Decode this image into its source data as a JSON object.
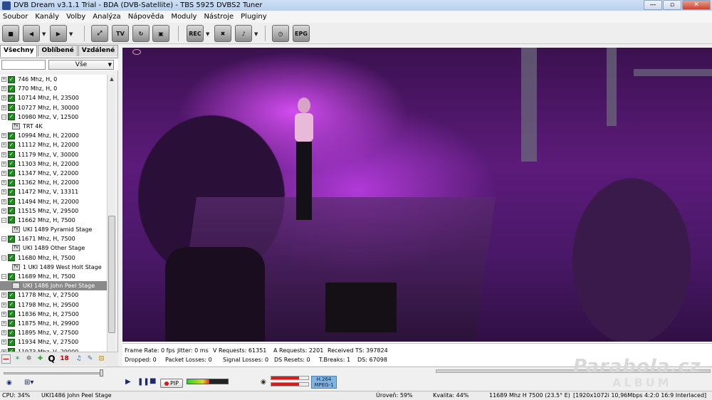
{
  "window": {
    "title": "DVB Dream v3.1.1 Trial - BDA (DVB-Satellite)  -  TBS 5925 DVBS2 Tuner",
    "minimize": "—",
    "restore": "▫",
    "close": "✕"
  },
  "menu": [
    "Soubor",
    "Kanály",
    "Volby",
    "Analýza",
    "Nápověda",
    "Moduly",
    "Nástroje",
    "Pluginy"
  ],
  "toolbar": {
    "tv_label": "TV",
    "rec_label": "REC",
    "epg_label": "EPG"
  },
  "sidebar": {
    "tabs": [
      "Všechny",
      "Oblíbené",
      "Vzdálené"
    ],
    "filter_value": "",
    "filter_select": "Vše",
    "tree": [
      {
        "label": "746 Mhz, H, 0",
        "type": "tp"
      },
      {
        "label": "770 Mhz, H, 0",
        "type": "tp"
      },
      {
        "label": "10714 Mhz, H, 23500",
        "type": "tp"
      },
      {
        "label": "10727 Mhz, H, 30000",
        "type": "tp"
      },
      {
        "label": "10980 Mhz, V, 12500",
        "type": "tp",
        "expanded": true
      },
      {
        "label": "TRT 4K",
        "type": "ch"
      },
      {
        "label": "10994 Mhz, H, 22000",
        "type": "tp"
      },
      {
        "label": "11112 Mhz, H, 22000",
        "type": "tp"
      },
      {
        "label": "11179 Mhz, V, 30000",
        "type": "tp"
      },
      {
        "label": "11303 Mhz, H, 22000",
        "type": "tp"
      },
      {
        "label": "11347 Mhz, V, 22000",
        "type": "tp"
      },
      {
        "label": "11362 Mhz, H, 22000",
        "type": "tp"
      },
      {
        "label": "11472 Mhz, V, 13311",
        "type": "tp"
      },
      {
        "label": "11494 Mhz, H, 22000",
        "type": "tp"
      },
      {
        "label": "11515 Mhz, V, 29500",
        "type": "tp"
      },
      {
        "label": "11662 Mhz, H, 7500",
        "type": "tp",
        "expanded": true
      },
      {
        "label": "UKI 1489 Pyramid Stage",
        "type": "ch"
      },
      {
        "label": "11671 Mhz, H, 7500",
        "type": "tp",
        "expanded": true
      },
      {
        "label": "UKI 1489 Other Stage",
        "type": "ch"
      },
      {
        "label": "11680 Mhz, H, 7500",
        "type": "tp",
        "expanded": true
      },
      {
        "label": "1 UKI 1489 West Holt Stage",
        "type": "ch"
      },
      {
        "label": "11689 Mhz, H, 7500",
        "type": "tp",
        "expanded": true
      },
      {
        "label": "UKI 1486 John Peel Stage",
        "type": "ch",
        "selected": true
      },
      {
        "label": "11778 Mhz, V, 27500",
        "type": "tp"
      },
      {
        "label": "11798 Mhz, H, 29500",
        "type": "tp"
      },
      {
        "label": "11836 Mhz, H, 27500",
        "type": "tp"
      },
      {
        "label": "11875 Mhz, H, 29900",
        "type": "tp"
      },
      {
        "label": "11895 Mhz, V, 27500",
        "type": "tp"
      },
      {
        "label": "11934 Mhz, V, 27500",
        "type": "tp"
      },
      {
        "label": "11973 Mhz, V, 29000",
        "type": "tp"
      }
    ]
  },
  "stats": {
    "frame_rate": "Frame Rate: 0 fps",
    "jitter": "Jitter: 0 ms",
    "v_requests": "V Requests: 61351",
    "a_requests": "A Requests: 2201",
    "received_ts": "Received TS: 397824",
    "dropped": "Dropped: 0",
    "packet_losses": "Packet Losses: 0",
    "signal_losses": "Signal Losses: 0",
    "ds_resets": "DS Resets: 0",
    "t_breaks": "T.Breaks: 1",
    "ds": "DS: 67098"
  },
  "iconbar": {
    "q_label": "Q",
    "age_label": "18"
  },
  "controls": {
    "pip_label": "PIP",
    "codec_video": "H.264",
    "codec_audio": "MPEG-1",
    "volume_level": 0.55,
    "audio_level": 0.75
  },
  "watermark": {
    "line1": "Parabola.cz",
    "line2": "ALBUM"
  },
  "statusbar": {
    "cpu": "CPU: 34%",
    "channel": "UKI1486 John Peel Stage",
    "level": "Úroveň: 59%",
    "quality": "Kvalita: 44%",
    "frequency": "11689 Mhz  H  7500   (23.5° E)",
    "video_info": "[1920x1072i 10,96Mbps 4:2:0  16:9 Interlaced]"
  },
  "colors": {
    "check_green": "#1d8c1d",
    "selected_row": "#8a8a8a",
    "video_purple": "#5c1b7a",
    "codec_blue": "#7fb3e0"
  }
}
